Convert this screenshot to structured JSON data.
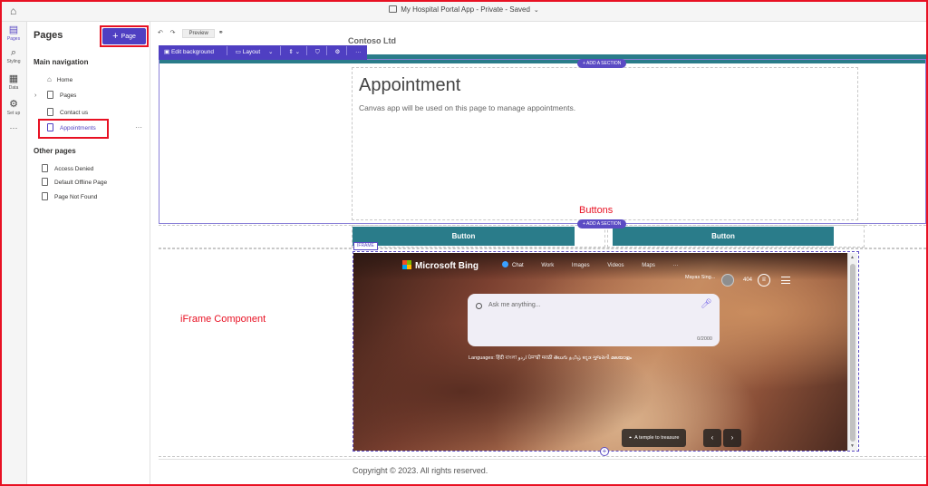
{
  "app": {
    "title": "My Hospital Portal App - Private - Saved"
  },
  "rail": {
    "items": [
      {
        "icon": "pages-icon",
        "label": "Pages"
      },
      {
        "icon": "styling-icon",
        "label": "Styling"
      },
      {
        "icon": "data-icon",
        "label": "Data"
      },
      {
        "icon": "setup-icon",
        "label": "Set up"
      },
      {
        "icon": "more-icon",
        "label": "···"
      }
    ]
  },
  "panel": {
    "title": "Pages",
    "add_button": "Page",
    "main_nav_heading": "Main navigation",
    "main_nav": [
      "Home",
      "Pages",
      "Contact us",
      "Appointments"
    ],
    "other_heading": "Other pages",
    "other_pages": [
      "Access Denied",
      "Default Offline Page",
      "Page Not Found"
    ],
    "more_dots": "···"
  },
  "editor": {
    "undo": "↶",
    "redo": "↷",
    "preview": "Preview",
    "toolbar": {
      "edit_background": "Edit background",
      "layout": "Layout"
    },
    "header_fragment": "Contoso Ltd",
    "add_section": "ADD A SECTION",
    "page_title": "Appointment",
    "page_desc": "Canvas app will be used on this page to manage appointments.",
    "buttons": [
      "Button",
      "Button"
    ],
    "iframe_tag": "IFRAME",
    "copyright": "Copyright © 2023. All rights reserved."
  },
  "annotations": {
    "buttons": "Buttons",
    "iframe": "iFrame Component"
  },
  "bing": {
    "logo": "Microsoft Bing",
    "nav": [
      "Chat",
      "Work",
      "Images",
      "Videos",
      "Maps"
    ],
    "more": "···",
    "user": "Mayas Sing...",
    "points": "404",
    "search_placeholder": "Ask me anything...",
    "char_count": "0/2000",
    "languages": "Languages: हिंदी বাংলা اردو ਪੰਜਾਬੀ मराठी తెలుగు தமிழ் ಕನ್ನಡ ગુજરાતી മലയാളം",
    "image_caption": "A temple to treasure"
  },
  "colors": {
    "accent": "#4f3fc2",
    "teal": "#2a7c8a",
    "annotation": "#e81123"
  }
}
